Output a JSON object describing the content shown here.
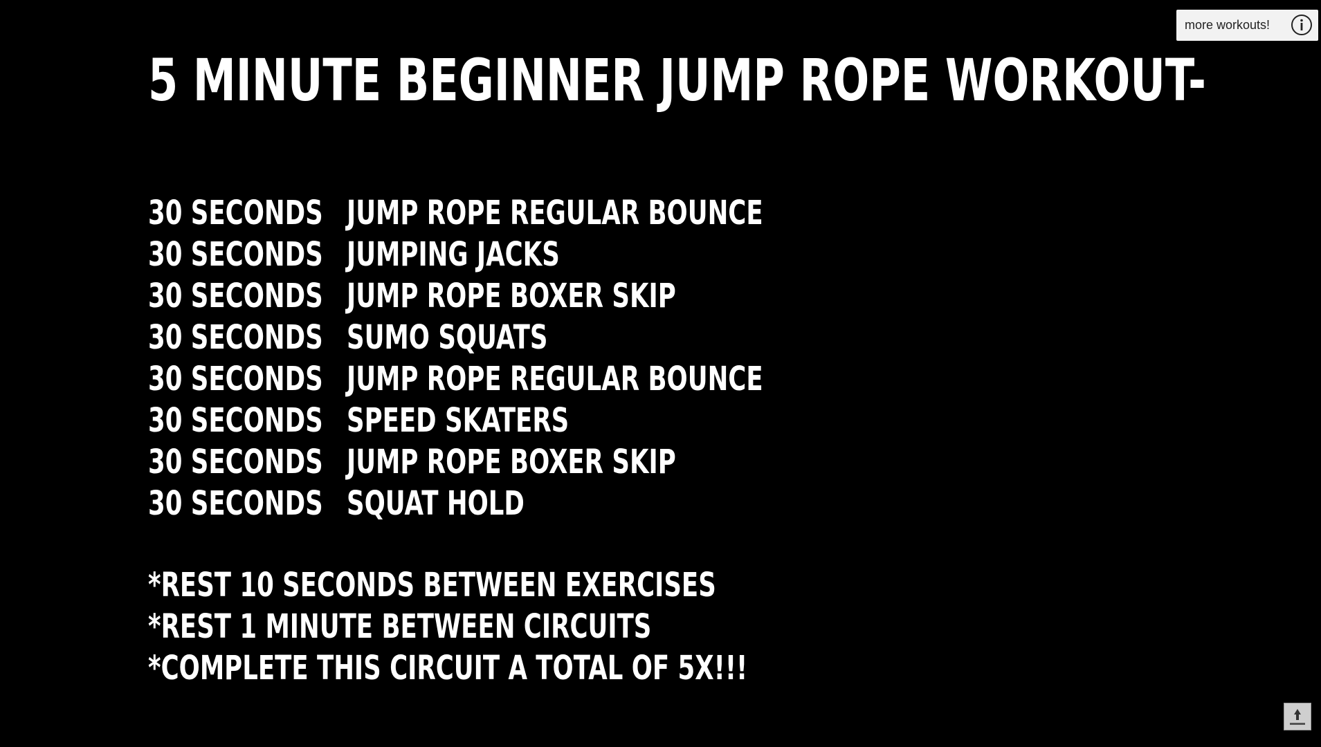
{
  "video": {
    "title": "5 MINUTE BEGINNER JUMP ROPE WORKOUT-",
    "circuit": [
      {
        "duration": "30 SECONDS",
        "exercise": "JUMP ROPE REGULAR BOUNCE"
      },
      {
        "duration": "30 SECONDS",
        "exercise": "JUMPING JACKS"
      },
      {
        "duration": "30 SECONDS",
        "exercise": "JUMP ROPE BOXER SKIP"
      },
      {
        "duration": "30 SECONDS",
        "exercise": "SUMO SQUATS"
      },
      {
        "duration": "30 SECONDS",
        "exercise": "JUMP ROPE REGULAR BOUNCE"
      },
      {
        "duration": "30 SECONDS",
        "exercise": "SPEED SKATERS"
      },
      {
        "duration": "30 SECONDS",
        "exercise": "JUMP ROPE BOXER SKIP"
      },
      {
        "duration": "30 SECONDS",
        "exercise": "SQUAT HOLD"
      }
    ],
    "notes": [
      "*REST 10 SECONDS BETWEEN EXERCISES",
      "*REST 1 MINUTE BETWEEN CIRCUITS",
      "*COMPLETE THIS CIRCUIT A TOTAL OF 5X!!!"
    ]
  },
  "info_card": {
    "label": "more workouts!",
    "icon": "info-icon"
  },
  "watermark": {
    "icon": "subscribe-watermark-icon"
  },
  "colors": {
    "background": "#000000",
    "text": "#ffffff",
    "card_background": "#f2f2f2"
  }
}
